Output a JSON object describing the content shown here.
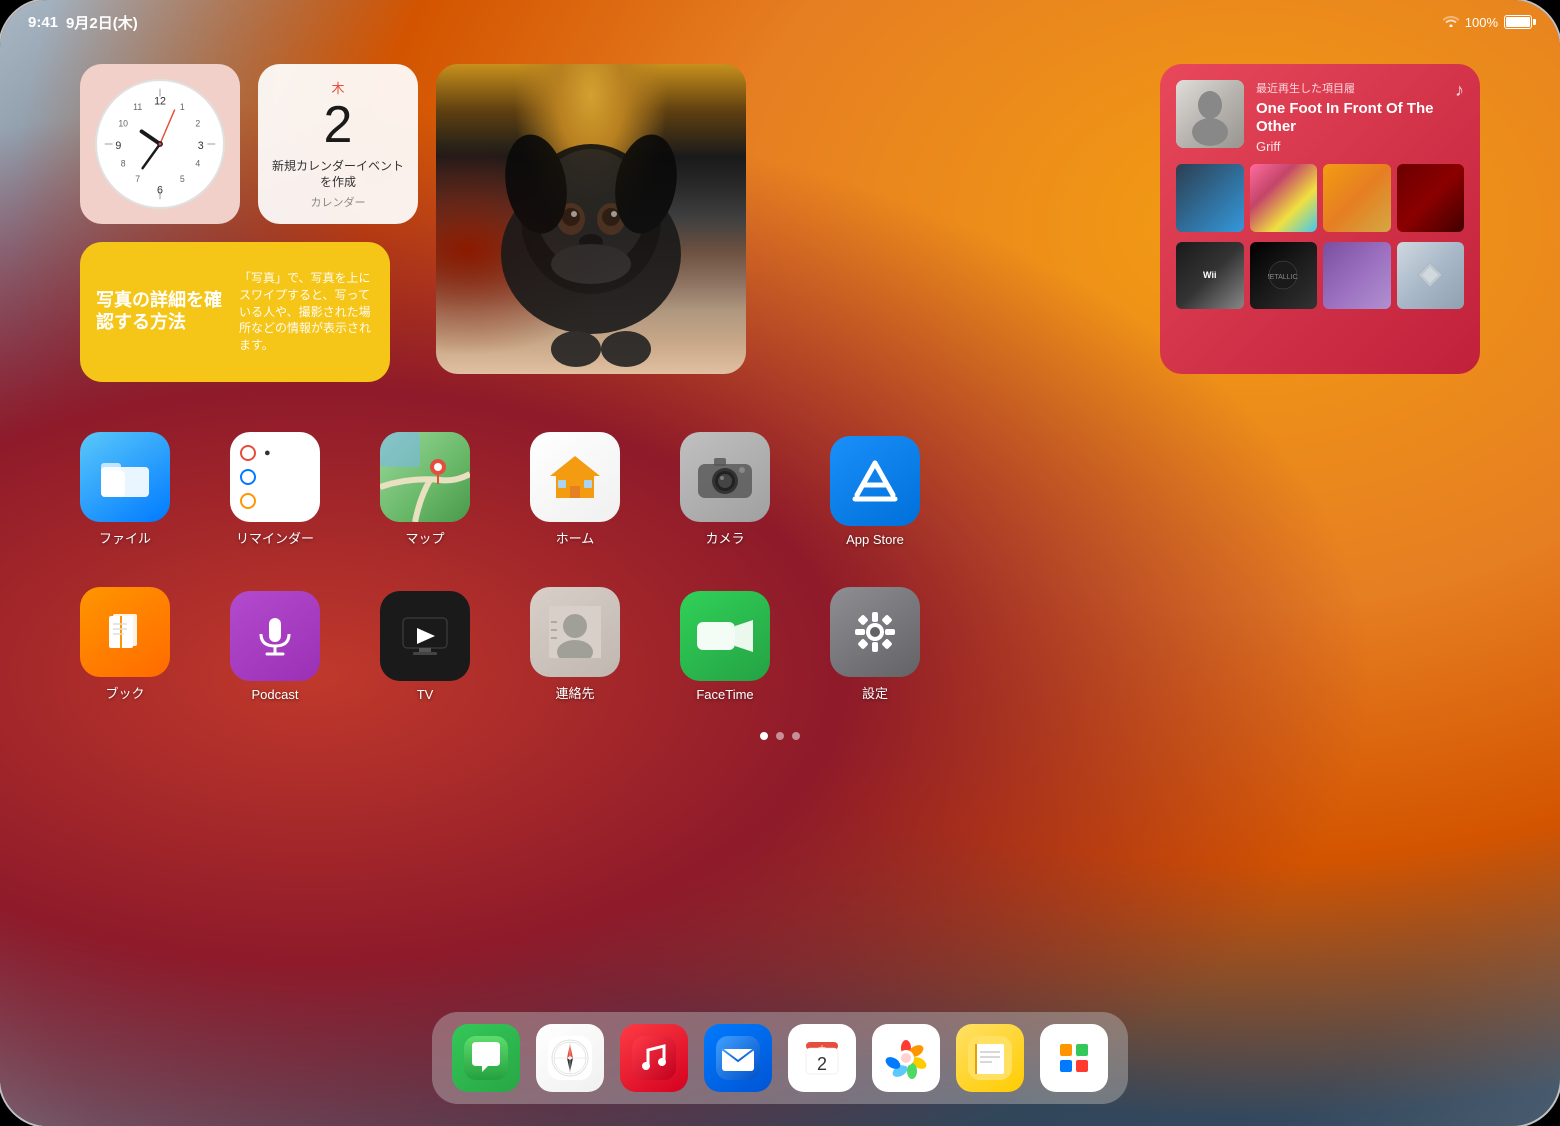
{
  "status_bar": {
    "time": "9:41",
    "date": "9月2日(木)",
    "wifi": "100%",
    "battery": "100%"
  },
  "widgets": {
    "clock": {
      "label": "時計"
    },
    "calendar": {
      "day_name": "木",
      "day_number": "2",
      "event_title": "新規カレンダーイ\nベントを作成",
      "sub": "カレンダー"
    },
    "photo": {
      "label": "写真"
    },
    "tips": {
      "title": "写真の詳細を確認する方法",
      "description": "「写真」で、写真を上にスワイプすると、写っている人や、撮影された場所などの情報が表示されます。"
    },
    "music": {
      "recently_label": "最近再生した項目履",
      "song_title": "One Foot In Front Of The Other",
      "artist": "Griff",
      "note_icon": "♪"
    }
  },
  "apps": {
    "row1": [
      {
        "id": "files",
        "label": "ファイル"
      },
      {
        "id": "reminders",
        "label": "リマインダー"
      },
      {
        "id": "maps",
        "label": "マップ"
      },
      {
        "id": "home",
        "label": "ホーム"
      },
      {
        "id": "camera",
        "label": "カメラ"
      },
      {
        "id": "appstore",
        "label": "App Store"
      }
    ],
    "row2": [
      {
        "id": "books",
        "label": "ブック"
      },
      {
        "id": "podcasts",
        "label": "Podcast"
      },
      {
        "id": "tv",
        "label": "TV"
      },
      {
        "id": "contacts",
        "label": "連絡先"
      },
      {
        "id": "facetime",
        "label": "FaceTime"
      },
      {
        "id": "settings",
        "label": "設定"
      }
    ]
  },
  "dock": {
    "apps": [
      {
        "id": "messages",
        "label": "メッセージ"
      },
      {
        "id": "safari",
        "label": "Safari"
      },
      {
        "id": "music",
        "label": "ミュージック"
      },
      {
        "id": "mail",
        "label": "メール"
      },
      {
        "id": "calendar",
        "label": "カレンダー"
      },
      {
        "id": "photos",
        "label": "写真"
      },
      {
        "id": "notes",
        "label": "メモ"
      },
      {
        "id": "freeform",
        "label": "フリーボード"
      }
    ]
  },
  "page_dots": {
    "count": 3,
    "active": 0
  }
}
